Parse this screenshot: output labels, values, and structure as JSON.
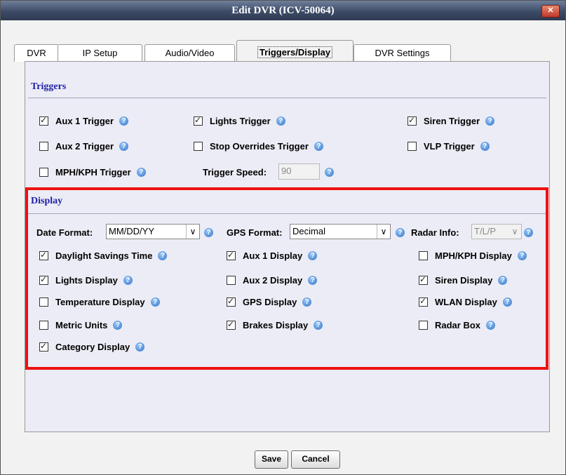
{
  "window": {
    "title": "Edit DVR (ICV-50064)",
    "close_glyph": "✕"
  },
  "tabs": [
    {
      "label": "DVR",
      "active": false
    },
    {
      "label": "IP Setup",
      "active": false
    },
    {
      "label": "Audio/Video",
      "active": false
    },
    {
      "label": "Triggers/Display",
      "active": true
    },
    {
      "label": "DVR Settings",
      "active": false
    }
  ],
  "triggers": {
    "title": "Triggers",
    "items": [
      {
        "label": "Aux 1 Trigger",
        "checked": true
      },
      {
        "label": "Lights Trigger",
        "checked": true
      },
      {
        "label": "Siren Trigger",
        "checked": true
      },
      {
        "label": "Aux 2 Trigger",
        "checked": false
      },
      {
        "label": "Stop Overrides Trigger",
        "checked": false
      },
      {
        "label": "VLP Trigger",
        "checked": false
      },
      {
        "label": "MPH/KPH Trigger",
        "checked": false
      }
    ],
    "speed_label": "Trigger Speed:",
    "speed_value": "90"
  },
  "display": {
    "title": "Display",
    "date_format_label": "Date Format:",
    "date_format_value": "MM/DD/YY",
    "gps_format_label": "GPS Format:",
    "gps_format_value": "Decimal",
    "radar_info_label": "Radar Info:",
    "radar_info_value": "T/L/P",
    "items": [
      {
        "label": "Daylight Savings Time",
        "checked": true
      },
      {
        "label": "Aux 1 Display",
        "checked": true
      },
      {
        "label": "MPH/KPH Display",
        "checked": false
      },
      {
        "label": "Lights Display",
        "checked": true
      },
      {
        "label": "Aux 2 Display",
        "checked": false
      },
      {
        "label": "Siren Display",
        "checked": true
      },
      {
        "label": "Temperature Display",
        "checked": false
      },
      {
        "label": "GPS Display",
        "checked": true
      },
      {
        "label": "WLAN Display",
        "checked": true
      },
      {
        "label": "Metric Units",
        "checked": false
      },
      {
        "label": "Brakes Display",
        "checked": true
      },
      {
        "label": "Radar Box",
        "checked": false
      },
      {
        "label": "Category Display",
        "checked": true
      }
    ]
  },
  "help_glyph": "?",
  "dropdown_glyph": "∨",
  "buttons": {
    "save": "Save",
    "cancel": "Cancel"
  },
  "colors": {
    "section_title": "#1f1fa8",
    "highlight_box": "#ee1111",
    "titlebar": "#3d4b66"
  }
}
